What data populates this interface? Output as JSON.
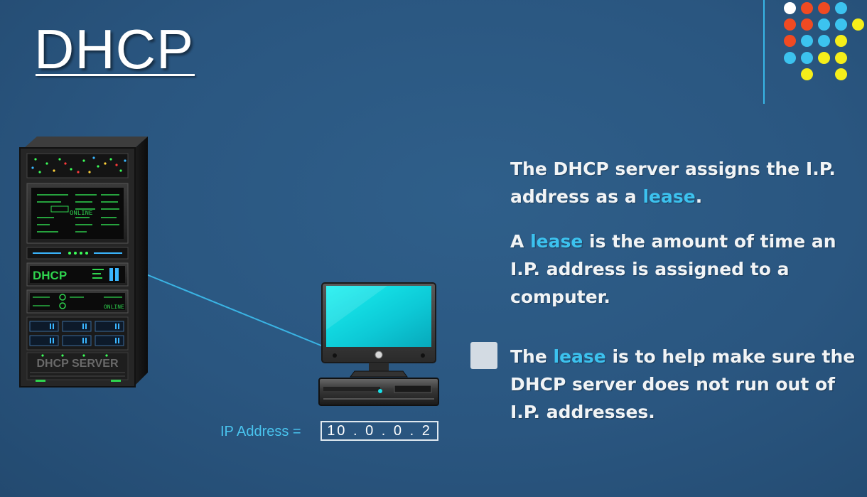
{
  "title": "DHCP",
  "server": {
    "front_label": "DHCP",
    "base_label": "DHCP SERVER",
    "status_label": "ONLINE"
  },
  "computer": {
    "ip_label": "IP Address =",
    "ip_value": "10 . 0 . 0 . 2"
  },
  "text": {
    "p1_a": "The DHCP server assigns the I.P. address as a ",
    "p1_b": "lease",
    "p1_c": ".",
    "p2_a": "A ",
    "p2_b": "lease",
    "p2_c": " is the amount of time an I.P. address is assigned to a computer.",
    "p3_a": "The ",
    "p3_b": "lease",
    "p3_c": " is to help make sure the DHCP server does not run out of I.P. addresses."
  },
  "colors": {
    "background": "#2a5680",
    "highlight": "#3cc2ef",
    "connection_line": "#3ab4e4",
    "dot_white": "#ffffff",
    "dot_red": "#f04a22",
    "dot_blue": "#3cc3ef",
    "dot_yellow": "#f5ee1a"
  }
}
